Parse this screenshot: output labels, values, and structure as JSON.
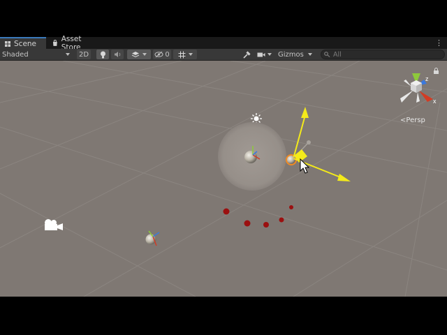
{
  "tabs": [
    {
      "label": "Scene",
      "icon": "grid-icon",
      "active": true
    },
    {
      "label": "Asset Store",
      "icon": "bag-icon",
      "active": false
    }
  ],
  "toolbar": {
    "draw_mode": "Shaded",
    "mode_2d": "2D",
    "hidden_count": "0",
    "gizmos": "Gizmos",
    "search_placeholder": "All"
  },
  "gizmo": {
    "projection": "Persp",
    "axis_x": "x",
    "axis_z": "z"
  },
  "colors": {
    "scene_bg": "#7f7873",
    "toolbar_bg": "#383838",
    "tab_accent": "#3a79bb",
    "move_handle": "#f4ea1a",
    "axis_x": "#d23c24",
    "axis_y": "#8ec93b",
    "axis_z": "#3a79de",
    "selection_outline": "#f08a24",
    "particle": "#9b1010"
  }
}
